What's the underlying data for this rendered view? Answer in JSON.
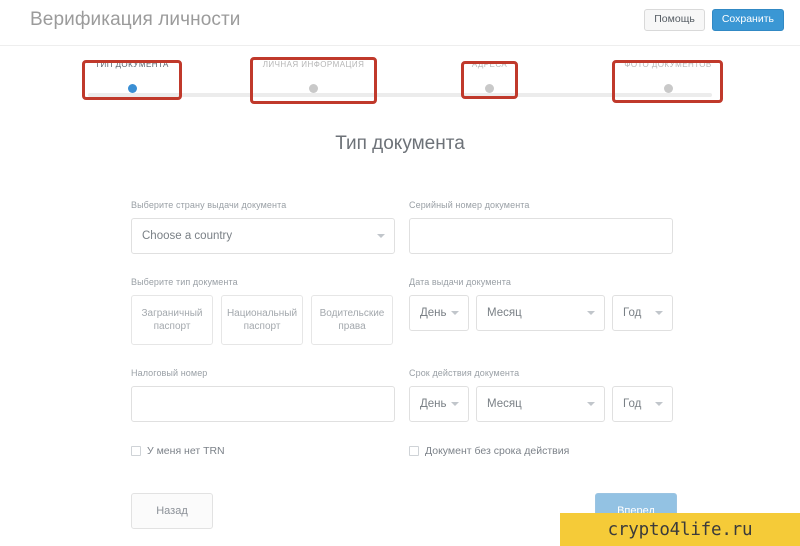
{
  "header": {
    "title": "Верификация личности",
    "help_label": "Помощь",
    "save_label": "Сохранить",
    "save_color": "#3a97d4"
  },
  "stepper": {
    "active_index": 0,
    "active_dot_color": "#3a8fd4",
    "inactive_dot_color": "#c9c9c9",
    "annotation_color": "#c0392b",
    "steps": [
      {
        "label": "ТИП ДОКУМЕНТА",
        "state": "active"
      },
      {
        "label": "ЛИЧНАЯ ИНФОРМАЦИЯ",
        "state": "inactive"
      },
      {
        "label": "АДРЕСА",
        "state": "inactive"
      },
      {
        "label": "ФОТО ДОКУМЕНТОВ",
        "state": "inactive"
      }
    ]
  },
  "form": {
    "heading": "Тип документа",
    "country": {
      "label": "Выберите страну выдачи документа",
      "value": "Choose a country"
    },
    "serial": {
      "label": "Серийный номер документа",
      "value": "",
      "placeholder": ""
    },
    "doc_type": {
      "label": "Выберите тип документа",
      "options": [
        "Заграничный паспорт",
        "Национальный паспорт",
        "Водительские права"
      ]
    },
    "issue_date": {
      "label": "Дата выдачи документа",
      "day": "День",
      "month": "Месяц",
      "year": "Год"
    },
    "tax_number": {
      "label": "Налоговый номер",
      "value": "",
      "placeholder": ""
    },
    "expiry_date": {
      "label": "Срок действия документа",
      "day": "День",
      "month": "Месяц",
      "year": "Год"
    },
    "no_trn": {
      "label": "У меня нет TRN",
      "checked": false
    },
    "no_expiry": {
      "label": "Документ без срока действия",
      "checked": false
    },
    "back_label": "Назад",
    "next_label": "Вперед"
  },
  "watermark": {
    "text": "crypto4life.ru",
    "background": "#f5cb38"
  }
}
